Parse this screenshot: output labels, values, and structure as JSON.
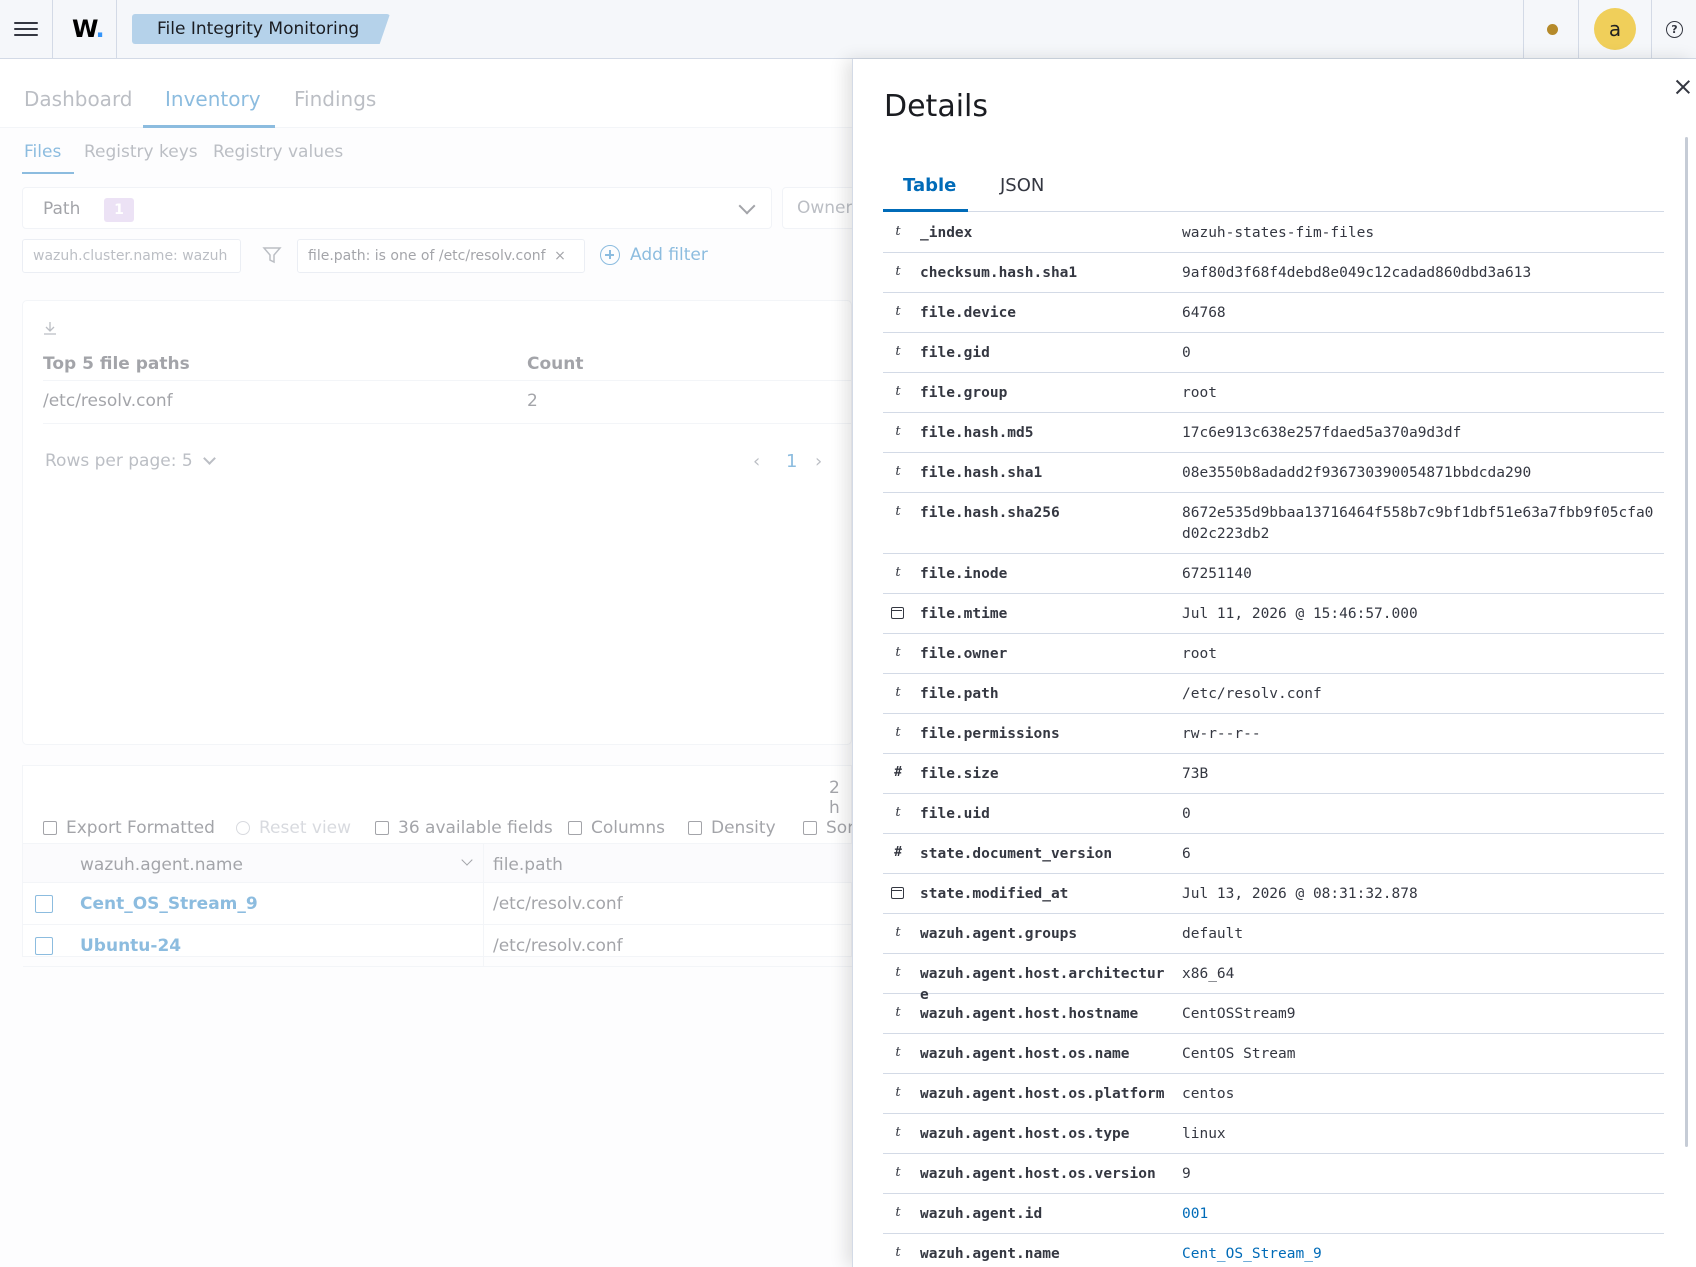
{
  "header": {
    "logo_text": "W",
    "logo_dot": ".",
    "breadcrumb": "File Integrity Monitoring",
    "avatar_letter": "a",
    "help_glyph": "?",
    "icons": [
      "menu-icon",
      "notification-dot-icon",
      "help-icon"
    ]
  },
  "tabs": {
    "main": [
      "Dashboard",
      "Inventory",
      "Findings"
    ],
    "main_active": "Inventory",
    "sub": [
      "Files",
      "Registry keys",
      "Registry values"
    ],
    "sub_active": "Files"
  },
  "filters": {
    "path_label": "Path",
    "path_count": "1",
    "owner_label": "Owner",
    "pill_cluster": "wazuh.cluster.name: wazuh",
    "pill_path": "file.path: is one of /etc/resolv.conf",
    "pill_remove": "×",
    "add_filter": "Add filter"
  },
  "top5": {
    "col_path": "Top 5 file paths",
    "col_count": "Count",
    "rows": [
      {
        "path": "/etc/resolv.conf",
        "count": "2"
      }
    ],
    "rows_per_page": "Rows per page: 5",
    "page": "1",
    "prev": "‹",
    "next": "›"
  },
  "grid": {
    "hits": "2 h",
    "toolbar": {
      "export": "Export Formatted",
      "reset": "Reset view",
      "fields": "36 available fields",
      "columns": "Columns",
      "density": "Density",
      "sort": "Sor"
    },
    "columns": [
      "wazuh.agent.name",
      "file.path"
    ],
    "rows": [
      {
        "agent": "Cent_OS_Stream_9",
        "path": "/etc/resolv.conf"
      },
      {
        "agent": "Ubuntu-24",
        "path": "/etc/resolv.conf"
      }
    ]
  },
  "details": {
    "title": "Details",
    "tabs": [
      "Table",
      "JSON"
    ],
    "active_tab": "Table",
    "rows": [
      {
        "type": "t",
        "key": "_index",
        "value": "wazuh-states-fim-files"
      },
      {
        "type": "t",
        "key": "checksum.hash.sha1",
        "value": "9af80d3f68f4debd8e049c12cadad860dbd3a613"
      },
      {
        "type": "t",
        "key": "file.device",
        "value": "64768"
      },
      {
        "type": "t",
        "key": "file.gid",
        "value": "0"
      },
      {
        "type": "t",
        "key": "file.group",
        "value": "root"
      },
      {
        "type": "t",
        "key": "file.hash.md5",
        "value": "17c6e913c638e257fdaed5a370a9d3df"
      },
      {
        "type": "t",
        "key": "file.hash.sha1",
        "value": "08e3550b8adadd2f936730390054871bbdcda290"
      },
      {
        "type": "t",
        "key": "file.hash.sha256",
        "value": "8672e535d9bbaa13716464f558b7c9bf1dbf51e63a7fbb9f05cfa0d02c223db2"
      },
      {
        "type": "t",
        "key": "file.inode",
        "value": "67251140"
      },
      {
        "type": "date",
        "key": "file.mtime",
        "value": "Jul 11, 2026 @ 15:46:57.000"
      },
      {
        "type": "t",
        "key": "file.owner",
        "value": "root"
      },
      {
        "type": "t",
        "key": "file.path",
        "value": "/etc/resolv.conf"
      },
      {
        "type": "t",
        "key": "file.permissions",
        "value": "rw-r--r--"
      },
      {
        "type": "num",
        "key": "file.size",
        "value": "73B"
      },
      {
        "type": "t",
        "key": "file.uid",
        "value": "0"
      },
      {
        "type": "num",
        "key": "state.document_version",
        "value": "6"
      },
      {
        "type": "date",
        "key": "state.modified_at",
        "value": "Jul 13, 2026 @ 08:31:32.878"
      },
      {
        "type": "t",
        "key": "wazuh.agent.groups",
        "value": "default"
      },
      {
        "type": "t",
        "key": "wazuh.agent.host.architecture",
        "value": "x86_64"
      },
      {
        "type": "t",
        "key": "wazuh.agent.host.hostname",
        "value": "CentOSStream9"
      },
      {
        "type": "t",
        "key": "wazuh.agent.host.os.name",
        "value": "CentOS Stream"
      },
      {
        "type": "t",
        "key": "wazuh.agent.host.os.platform",
        "value": "centos"
      },
      {
        "type": "t",
        "key": "wazuh.agent.host.os.type",
        "value": "linux"
      },
      {
        "type": "t",
        "key": "wazuh.agent.host.os.version",
        "value": "9"
      },
      {
        "type": "t",
        "key": "wazuh.agent.id",
        "value": "001",
        "link": true
      },
      {
        "type": "t",
        "key": "wazuh.agent.name",
        "value": "Cent_OS_Stream_9",
        "link": true
      }
    ]
  },
  "colors": {
    "accent": "#006bb8",
    "breadcrumb_bg": "#b5d2ea",
    "avatar_bg": "#f0cf5a",
    "badge_bg": "#d4bfe8"
  }
}
